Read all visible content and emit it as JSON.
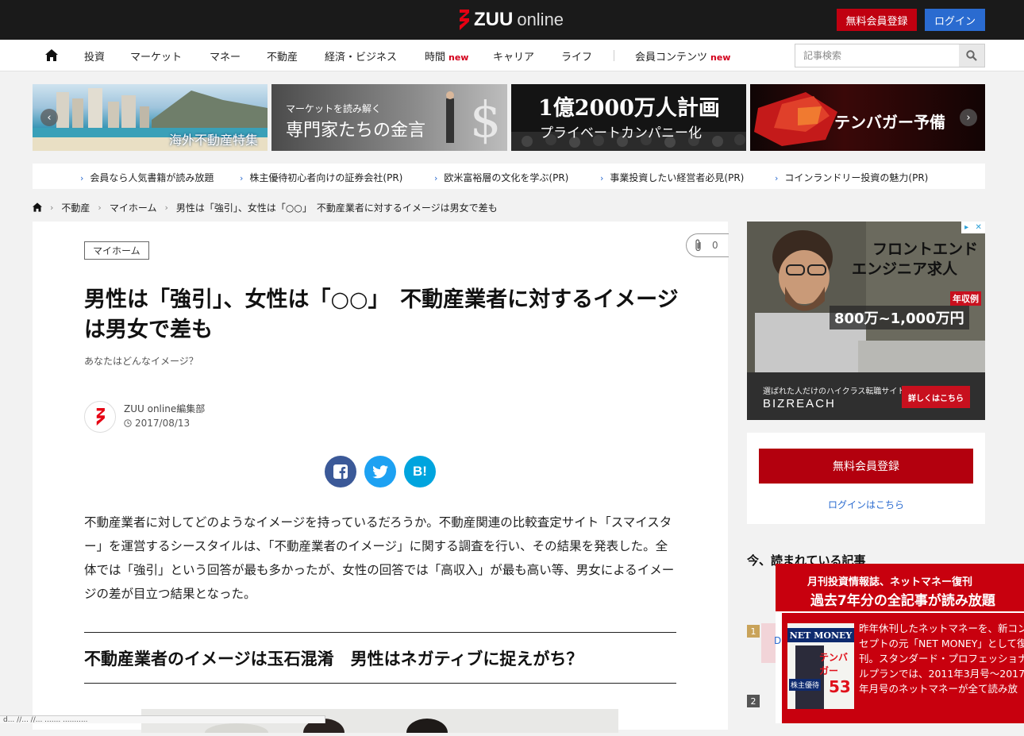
{
  "header": {
    "logo_brand": "ZUU",
    "logo_suffix": "online",
    "register_label": "無料会員登録",
    "login_label": "ログイン"
  },
  "nav": {
    "items": [
      {
        "label": "投資"
      },
      {
        "label": "マーケット"
      },
      {
        "label": "マネー"
      },
      {
        "label": "不動産"
      },
      {
        "label": "経済・ビジネス"
      },
      {
        "label": "時間",
        "badge": "new"
      },
      {
        "label": "キャリア"
      },
      {
        "label": "ライフ"
      },
      {
        "label": "会員コンテンツ",
        "badge": "new"
      }
    ],
    "search_placeholder": "記事検索"
  },
  "banners": [
    {
      "text": "海外不動産特集"
    },
    {
      "line1": "マーケットを読み解く",
      "line2": "専門家たちの金言"
    },
    {
      "line1": "1億2000万人計画",
      "line2": "プライベートカンパニー化"
    },
    {
      "text": "テンバガー予備"
    }
  ],
  "pr_links": [
    "会員なら人気書籍が読み放題",
    "株主優待初心者向けの証券会社(PR)",
    "欧米富裕層の文化を学ぶ(PR)",
    "事業投資したい経営者必見(PR)",
    "コインランドリー投資の魅力(PR)"
  ],
  "breadcrumb": [
    "不動産",
    "マイホーム",
    "男性は「強引」、女性は「○○」　不動産業者に対するイメージは男女で差も"
  ],
  "article": {
    "tag": "マイホーム",
    "clip_count": "0",
    "title": "男性は「強引」、女性は「○○」　不動産業者に対するイメージは男女で差も",
    "subtitle": "あなたはどんなイメージ？",
    "author": "ZUU online編集部",
    "date": "2017/08/13",
    "body": "不動産業者に対してどのようなイメージを持っているだろうか。不動産関連の比較査定サイト「スマイスター」を運営するシースタイルは、「不動産業者のイメージ」に関する調査を行い、その結果を発表した。全体では「強引」という回答が最も多かったが、女性の回答では「高収入」が最も高い等、男女によるイメージの差が目立つ結果となった。",
    "heading": "不動産業者のイメージは玉石混淆　男性はネガティブに捉えがち？"
  },
  "share": {
    "hatena_label": "B!"
  },
  "ad": {
    "line1": "フロントエンド",
    "line2": "エンジニア求人",
    "salary_label": "年収例",
    "salary": "800万~1,000万円",
    "tagline": "選ばれた人だけのハイクラス転職サイト",
    "cta": "詳しくはこちら",
    "brand": "BIZREACH"
  },
  "sidebar": {
    "register_label": "無料会員登録",
    "login_link": "ログインはこちら",
    "popular_heading": "今、読まれている記事",
    "ranks": [
      "1",
      "2"
    ]
  },
  "popup": {
    "line1": "月刊投資情報誌、ネットマネー復刊",
    "line2": "過去7年分の全記事が読み放題",
    "tab_fragment": "D",
    "magazine_title": "NET MONEY",
    "magazine_cover_text": "テンバガー",
    "magazine_sub": "株主優待",
    "magazine_number": "53",
    "body": "昨年休刊したネットマネーを、新コンセプトの元「NET MONEY」として復刊。スタンダード・プロフェッショナルプランでは、2011年3月号～2017年月号のネットマネーが全て読み放"
  },
  "status_bar": "d... //... //... ....... ..........."
}
